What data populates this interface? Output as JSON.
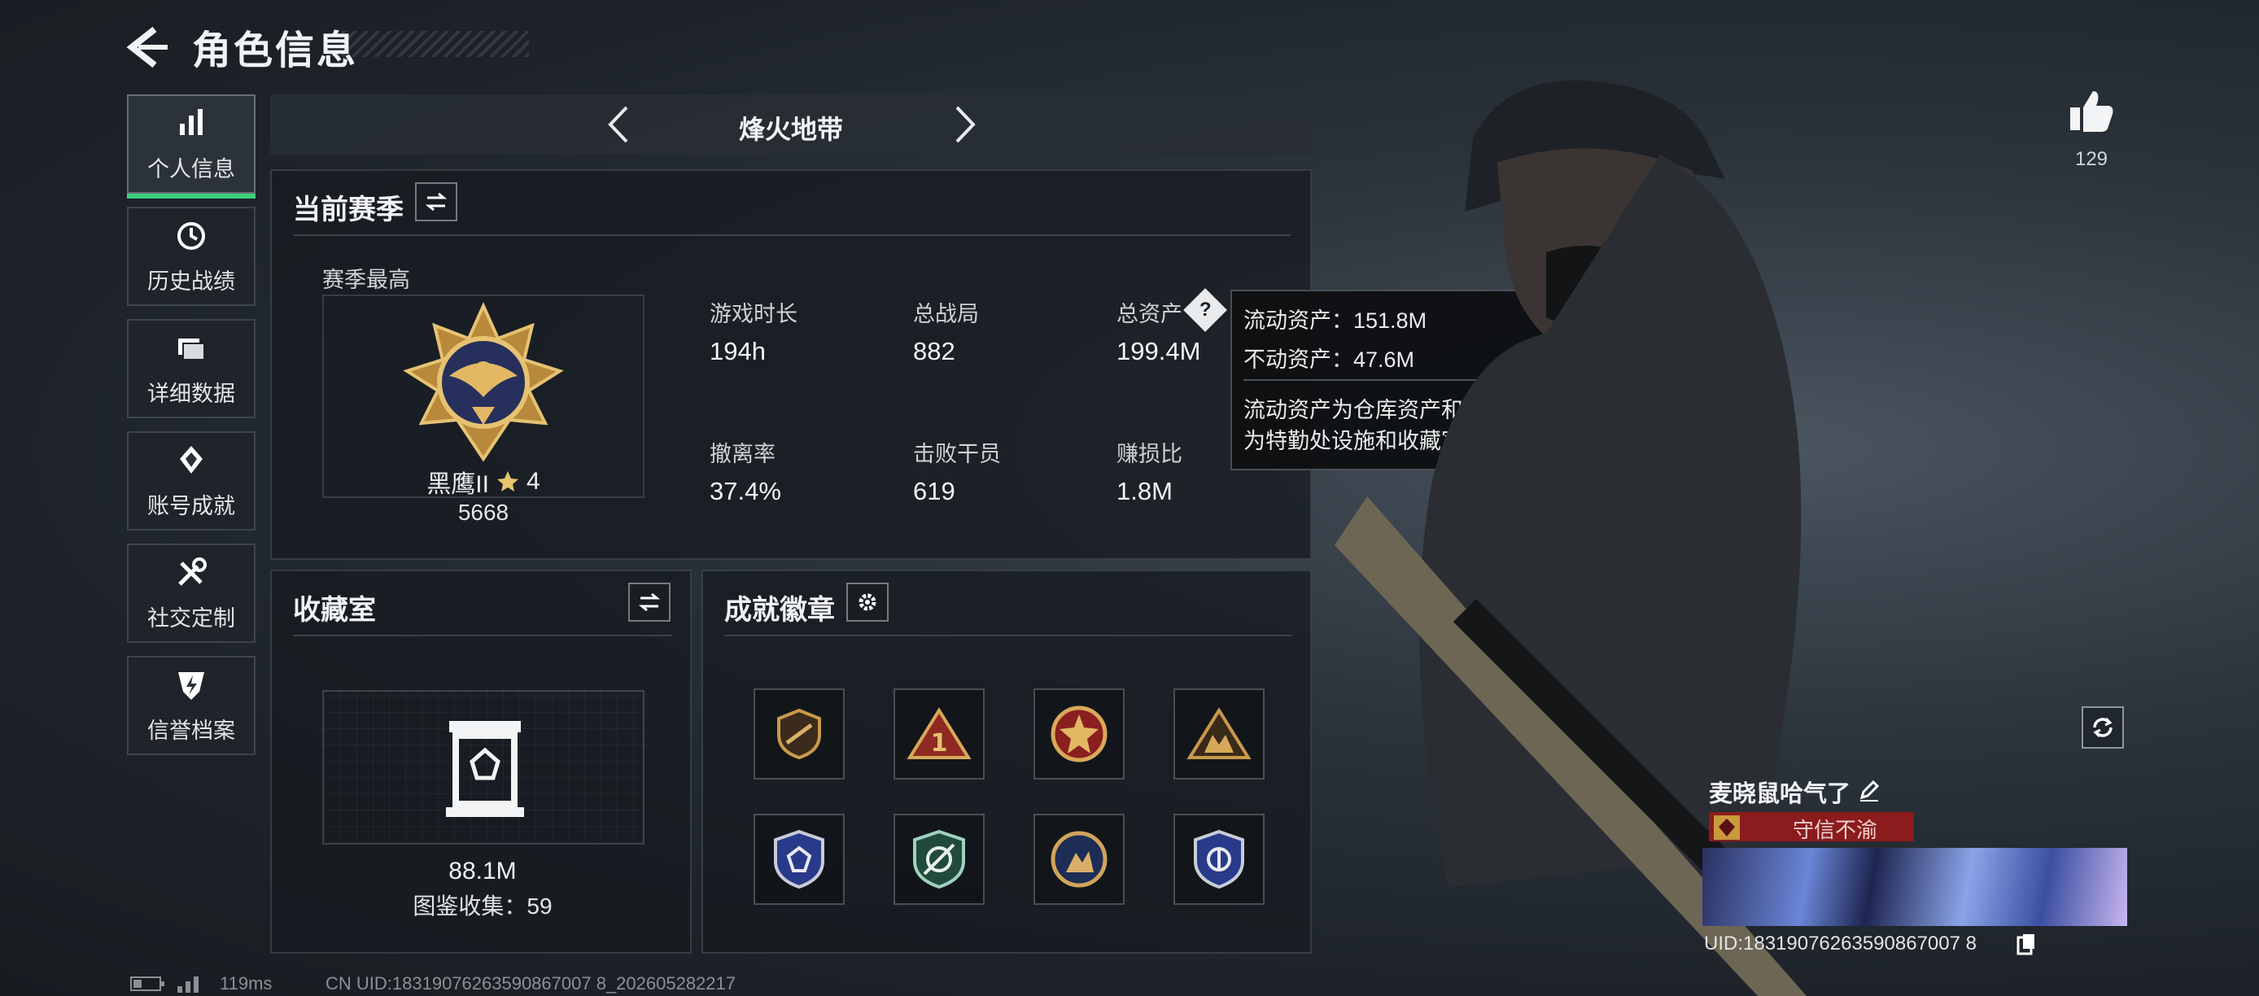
{
  "header": {
    "title": "角色信息"
  },
  "nav": {
    "items": [
      {
        "label": "个人信息",
        "icon": "bar-chart-icon"
      },
      {
        "label": "历史战绩",
        "icon": "history-clock-icon"
      },
      {
        "label": "详细数据",
        "icon": "folder-icon"
      },
      {
        "label": "账号成就",
        "icon": "diamond-award-icon"
      },
      {
        "label": "社交定制",
        "icon": "tools-icon"
      },
      {
        "label": "信誉档案",
        "icon": "shield-lightning-icon"
      }
    ]
  },
  "mode": {
    "title": "烽火地带"
  },
  "season": {
    "title": "当前赛季",
    "highest_label": "赛季最高",
    "rank_name": "黑鹰II",
    "rank_stars": "4",
    "rank_score": "5668",
    "stats": [
      {
        "label": "游戏时长",
        "value": "194h"
      },
      {
        "label": "总战局",
        "value": "882"
      },
      {
        "label": "总资产",
        "value": "199.4M"
      },
      {
        "label": "撤离率",
        "value": "37.4%"
      },
      {
        "label": "击败干员",
        "value": "619"
      },
      {
        "label": "赚损比",
        "value": "1.8M"
      }
    ]
  },
  "tooltip": {
    "line1": "流动资产：151.8M",
    "line2": "不动资产：47.6M",
    "desc1": "流动资产为仓库资产和哈夫币，不动资产",
    "desc2": "为特勤处设施和收藏室设施"
  },
  "collection": {
    "title": "收藏室",
    "value": "88.1M",
    "count": "图鉴收集：59"
  },
  "badges": {
    "title": "成就徽章"
  },
  "player": {
    "likes": "129",
    "name": "麦晓鼠哈气了",
    "reputation": "守信不渝",
    "uid_short": "UID:18319076263590867007 8"
  },
  "footer": {
    "ping": "119ms",
    "uid": "CN UID:18319076263590867007 8_202605282217"
  }
}
